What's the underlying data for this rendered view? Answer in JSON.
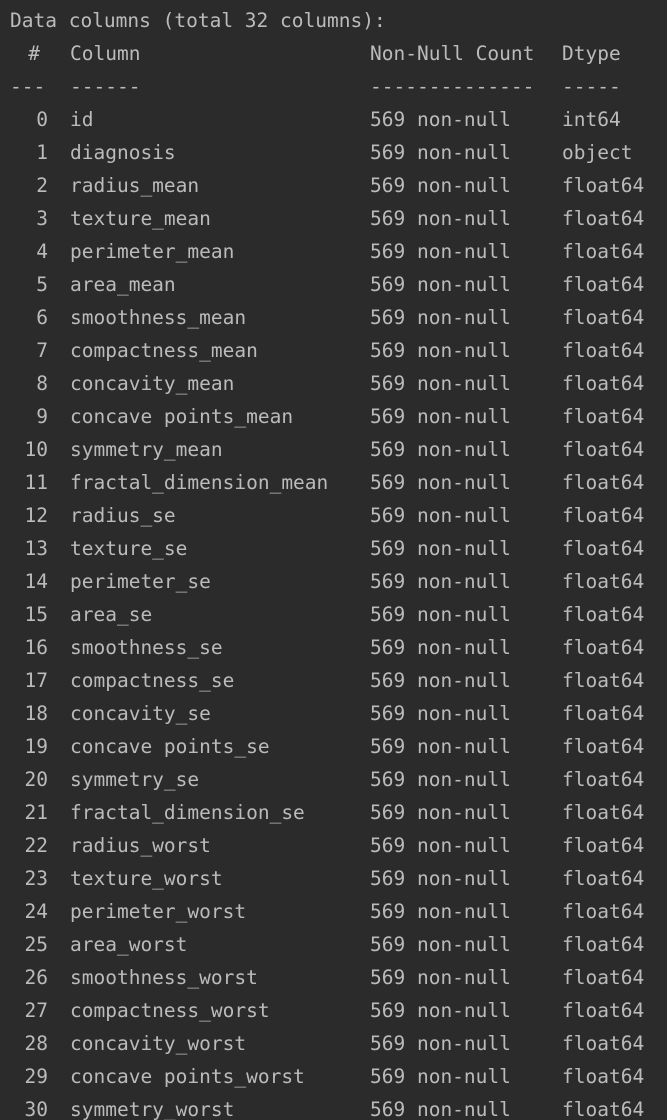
{
  "console": {
    "title": "Data columns (total 32 columns):",
    "headers": {
      "index": "#",
      "column": "Column",
      "count": "Non-Null Count",
      "dtype": "Dtype"
    },
    "separators": {
      "index": "---",
      "column": "------",
      "count": "--------------",
      "dtype": "-----"
    },
    "rows": [
      {
        "index": "0",
        "column": "id",
        "count": "569 non-null",
        "dtype": "int64"
      },
      {
        "index": "1",
        "column": "diagnosis",
        "count": "569 non-null",
        "dtype": "object"
      },
      {
        "index": "2",
        "column": "radius_mean",
        "count": "569 non-null",
        "dtype": "float64"
      },
      {
        "index": "3",
        "column": "texture_mean",
        "count": "569 non-null",
        "dtype": "float64"
      },
      {
        "index": "4",
        "column": "perimeter_mean",
        "count": "569 non-null",
        "dtype": "float64"
      },
      {
        "index": "5",
        "column": "area_mean",
        "count": "569 non-null",
        "dtype": "float64"
      },
      {
        "index": "6",
        "column": "smoothness_mean",
        "count": "569 non-null",
        "dtype": "float64"
      },
      {
        "index": "7",
        "column": "compactness_mean",
        "count": "569 non-null",
        "dtype": "float64"
      },
      {
        "index": "8",
        "column": "concavity_mean",
        "count": "569 non-null",
        "dtype": "float64"
      },
      {
        "index": "9",
        "column": "concave points_mean",
        "count": "569 non-null",
        "dtype": "float64"
      },
      {
        "index": "10",
        "column": "symmetry_mean",
        "count": "569 non-null",
        "dtype": "float64"
      },
      {
        "index": "11",
        "column": "fractal_dimension_mean",
        "count": "569 non-null",
        "dtype": "float64"
      },
      {
        "index": "12",
        "column": "radius_se",
        "count": "569 non-null",
        "dtype": "float64"
      },
      {
        "index": "13",
        "column": "texture_se",
        "count": "569 non-null",
        "dtype": "float64"
      },
      {
        "index": "14",
        "column": "perimeter_se",
        "count": "569 non-null",
        "dtype": "float64"
      },
      {
        "index": "15",
        "column": "area_se",
        "count": "569 non-null",
        "dtype": "float64"
      },
      {
        "index": "16",
        "column": "smoothness_se",
        "count": "569 non-null",
        "dtype": "float64"
      },
      {
        "index": "17",
        "column": "compactness_se",
        "count": "569 non-null",
        "dtype": "float64"
      },
      {
        "index": "18",
        "column": "concavity_se",
        "count": "569 non-null",
        "dtype": "float64"
      },
      {
        "index": "19",
        "column": "concave points_se",
        "count": "569 non-null",
        "dtype": "float64"
      },
      {
        "index": "20",
        "column": "symmetry_se",
        "count": "569 non-null",
        "dtype": "float64"
      },
      {
        "index": "21",
        "column": "fractal_dimension_se",
        "count": "569 non-null",
        "dtype": "float64"
      },
      {
        "index": "22",
        "column": "radius_worst",
        "count": "569 non-null",
        "dtype": "float64"
      },
      {
        "index": "23",
        "column": "texture_worst",
        "count": "569 non-null",
        "dtype": "float64"
      },
      {
        "index": "24",
        "column": "perimeter_worst",
        "count": "569 non-null",
        "dtype": "float64"
      },
      {
        "index": "25",
        "column": "area_worst",
        "count": "569 non-null",
        "dtype": "float64"
      },
      {
        "index": "26",
        "column": "smoothness_worst",
        "count": "569 non-null",
        "dtype": "float64"
      },
      {
        "index": "27",
        "column": "compactness_worst",
        "count": "569 non-null",
        "dtype": "float64"
      },
      {
        "index": "28",
        "column": "concavity_worst",
        "count": "569 non-null",
        "dtype": "float64"
      },
      {
        "index": "29",
        "column": "concave points_worst",
        "count": "569 non-null",
        "dtype": "float64"
      },
      {
        "index": "30",
        "column": "symmetry_worst",
        "count": "569 non-null",
        "dtype": "float64"
      }
    ]
  },
  "colors": {
    "background": "#2b2b2b",
    "text": "#bbbbbb"
  }
}
